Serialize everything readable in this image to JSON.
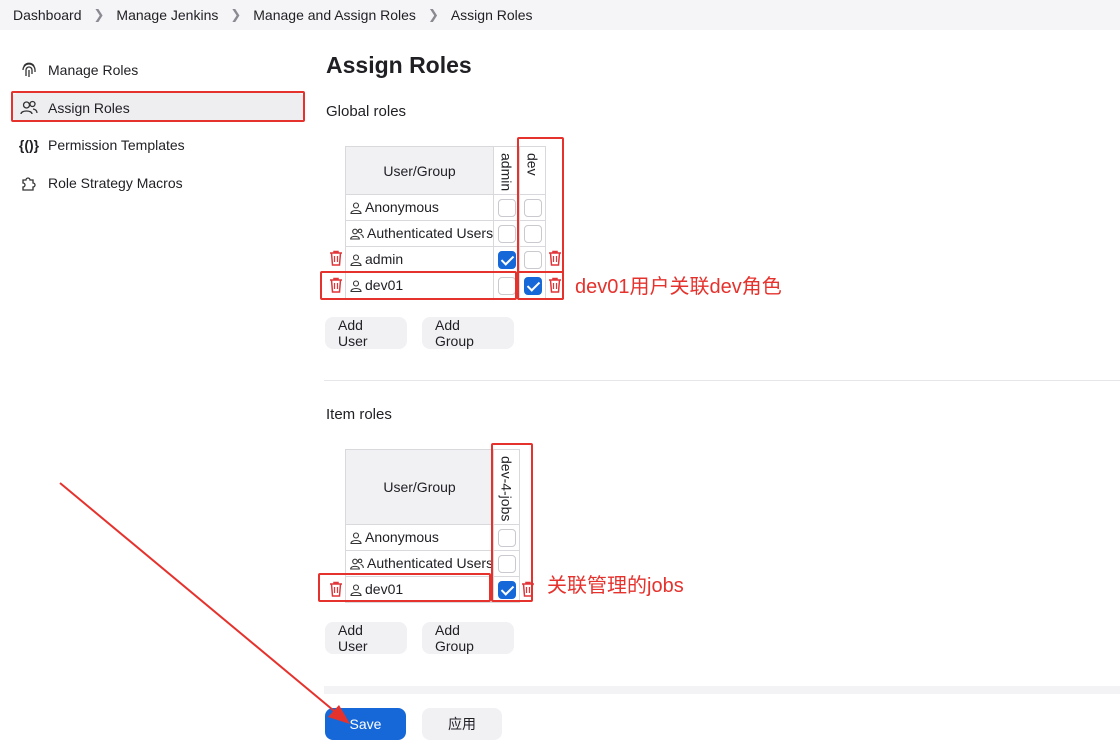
{
  "breadcrumb": [
    "Dashboard",
    "Manage Jenkins",
    "Manage and Assign Roles",
    "Assign Roles"
  ],
  "sidebar": {
    "items": [
      {
        "label": "Manage Roles",
        "icon": "fingerprint-icon"
      },
      {
        "label": "Assign Roles",
        "icon": "users-icon",
        "active": true
      },
      {
        "label": "Permission Templates",
        "icon": "braces-icon"
      },
      {
        "label": "Role Strategy Macros",
        "icon": "puzzle-icon"
      }
    ]
  },
  "page_title": "Assign Roles",
  "global_roles": {
    "title": "Global roles",
    "header": "User/Group",
    "roles": [
      "admin",
      "dev"
    ],
    "rows": [
      {
        "name": "Anonymous",
        "icon": "user-icon",
        "checks": [
          false,
          false
        ],
        "deletable": false
      },
      {
        "name": "Authenticated Users",
        "icon": "group-icon",
        "checks": [
          false,
          false
        ],
        "deletable": false
      },
      {
        "name": "admin",
        "icon": "user-icon",
        "checks": [
          true,
          false
        ],
        "deletable": true
      },
      {
        "name": "dev01",
        "icon": "user-icon",
        "checks": [
          false,
          true
        ],
        "deletable": true
      }
    ],
    "add_user": "Add User",
    "add_group": "Add Group"
  },
  "item_roles": {
    "title": "Item roles",
    "header": "User/Group",
    "roles": [
      "dev-4-jobs"
    ],
    "rows": [
      {
        "name": "Anonymous",
        "icon": "user-icon",
        "checks": [
          false
        ],
        "deletable": false
      },
      {
        "name": "Authenticated Users",
        "icon": "group-icon",
        "checks": [
          false
        ],
        "deletable": false
      },
      {
        "name": "dev01",
        "icon": "user-icon",
        "checks": [
          true
        ],
        "deletable": true
      }
    ],
    "add_user": "Add User",
    "add_group": "Add Group"
  },
  "footer": {
    "save": "Save",
    "apply": "应用"
  },
  "annotations": {
    "global": "dev01用户关联dev角色",
    "item": "关联管理的jobs"
  },
  "colors": {
    "accent": "#1668d8",
    "annotation": "#e5322d",
    "delete": "#e0353a"
  }
}
